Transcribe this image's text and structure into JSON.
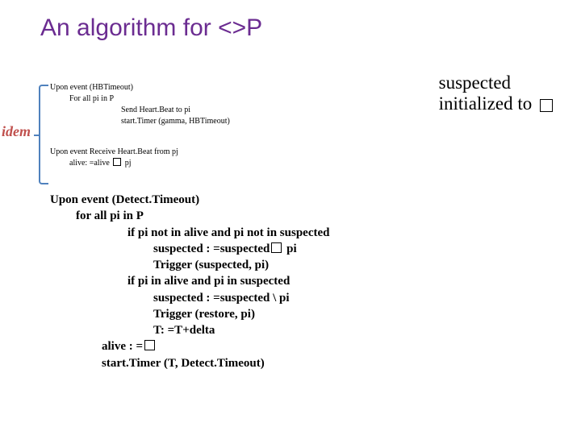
{
  "title": "An algorithm for <>P",
  "idem_label": "idem",
  "note": {
    "line1": "suspected",
    "line2_prefix": "initialized to"
  },
  "block1": {
    "l1": "Upon event (HBTimeout)",
    "l2": "For all pi in P",
    "l3": "Send Heart.Beat to pi",
    "l4": "start.Timer (gamma, HBTimeout)"
  },
  "block2": {
    "l1": "Upon event Receive Heart.Beat from pj",
    "l2_pre": "alive: =alive",
    "l2_post": "pj"
  },
  "block3": {
    "l1": "Upon event (Detect.Timeout)",
    "l2": "for all pi in P",
    "l3": "if pi not in alive and pi not in suspected",
    "l4_pre": "suspected : =suspected",
    "l4_post": "pi",
    "l5": "Trigger (suspected, pi)",
    "l6": "if pi in alive and pi in suspected",
    "l7": "suspected : =suspected \\ pi",
    "l8": "Trigger (restore, pi)",
    "l9": "T: =T+delta",
    "l10": "alive : =",
    "l11": "start.Timer (T, Detect.Timeout)"
  }
}
